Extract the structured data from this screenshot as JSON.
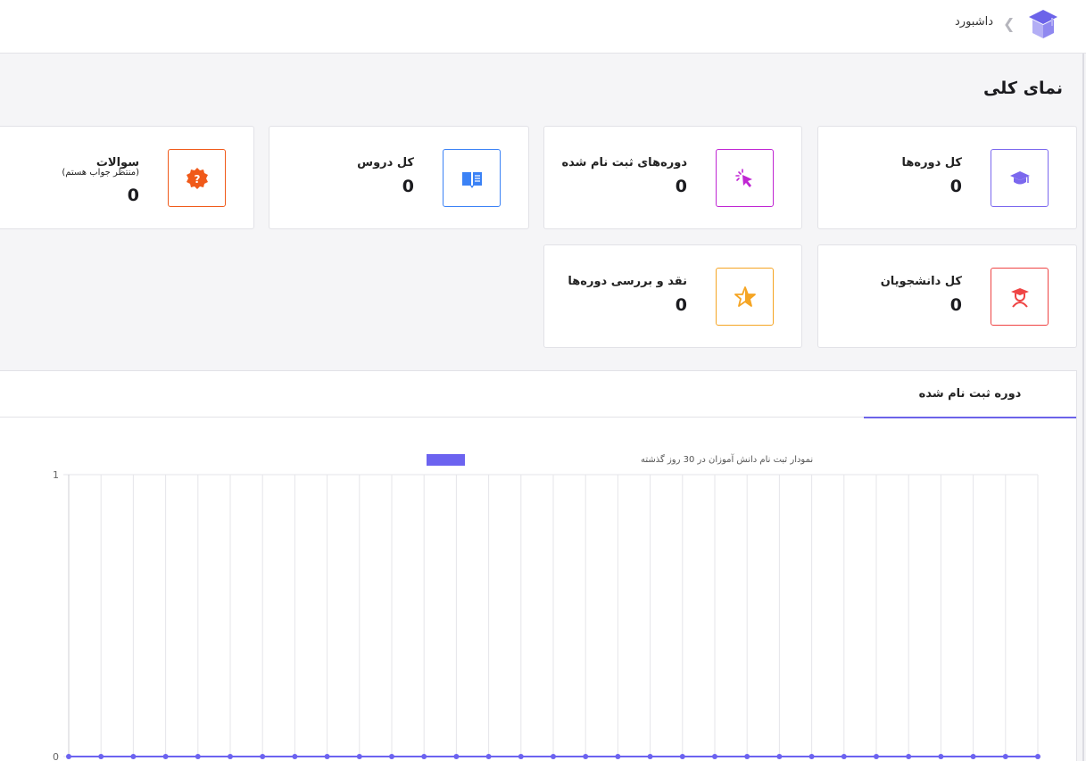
{
  "breadcrumb": {
    "current": "داشبورد"
  },
  "page": {
    "title": "نمای کلی"
  },
  "cards": {
    "total_courses": {
      "label": "کل دوره‌ها",
      "value": "0",
      "icon": "graduation-cap-icon",
      "color": "#7b68ee"
    },
    "enrolled_courses": {
      "label": "دوره‌های ثبت نام شده",
      "value": "0",
      "icon": "cursor-click-icon",
      "color": "#c026d3"
    },
    "total_lessons": {
      "label": "کل دروس",
      "value": "0",
      "icon": "book-open-icon",
      "color": "#3b82f6"
    },
    "questions": {
      "label": "سوالات",
      "sublabel": "(منتظر جواب هستم)",
      "value": "0",
      "icon": "question-badge-icon",
      "color": "#f05a1a"
    },
    "total_students": {
      "label": "کل دانشجویان",
      "value": "0",
      "icon": "student-icon",
      "color": "#ef4444"
    },
    "course_reviews": {
      "label": "نقد و بررسی دوره‌ها",
      "value": "0",
      "icon": "star-icon",
      "color": "#f5a524"
    }
  },
  "tabs": [
    {
      "label": "دوره ثبت نام شده",
      "active": true
    }
  ],
  "chart_data": {
    "type": "line",
    "title": "",
    "series": [
      {
        "name": "نمودار ثبت نام دانش آموزان در 30 روز گذشته",
        "color": "#6c63f0",
        "values": [
          0,
          0,
          0,
          0,
          0,
          0,
          0,
          0,
          0,
          0,
          0,
          0,
          0,
          0,
          0,
          0,
          0,
          0,
          0,
          0,
          0,
          0,
          0,
          0,
          0,
          0,
          0,
          0,
          0,
          0,
          0
        ]
      }
    ],
    "ylim": [
      0,
      1
    ],
    "yticks": [
      "0",
      "1"
    ],
    "grid": true,
    "legend_position": "top-center"
  }
}
